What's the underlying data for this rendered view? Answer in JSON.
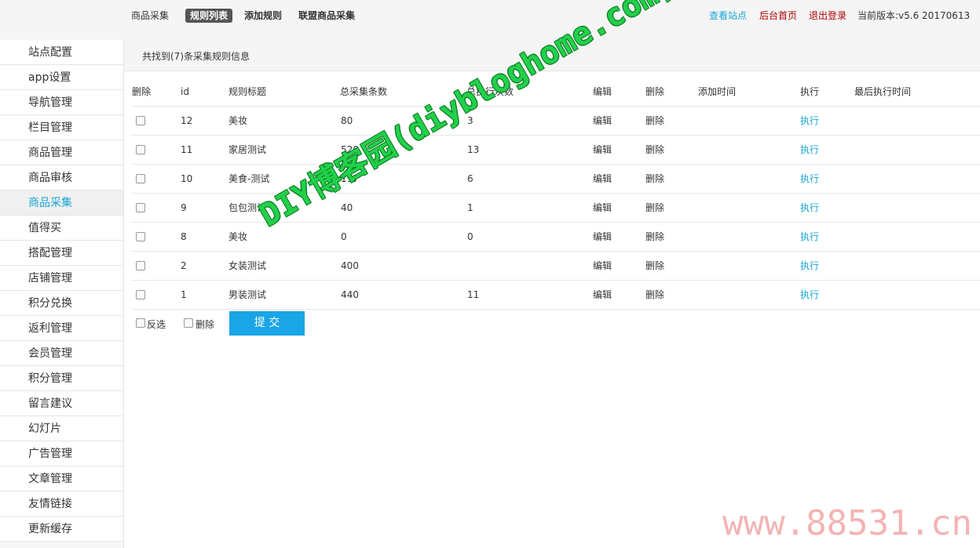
{
  "header": {
    "tabs": [
      "商品采集",
      "规则列表",
      "添加规则",
      "联盟商品采集"
    ],
    "active_tab": "规则列表",
    "links": {
      "view_site": "查看站点",
      "admin_home": "后台首页",
      "logout": "退出登录"
    },
    "version": "当前版本:v5.6 20170613"
  },
  "sidebar": {
    "items": [
      {
        "label": "站点配置"
      },
      {
        "label": "app设置"
      },
      {
        "label": "导航管理"
      },
      {
        "label": "栏目管理"
      },
      {
        "label": "商品管理"
      },
      {
        "label": "商品审核"
      },
      {
        "label": "商品采集",
        "active": true
      },
      {
        "label": "值得买"
      },
      {
        "label": "搭配管理"
      },
      {
        "label": "店铺管理"
      },
      {
        "label": "积分兑换"
      },
      {
        "label": "返利管理"
      },
      {
        "label": "会员管理"
      },
      {
        "label": "积分管理"
      },
      {
        "label": "留言建议"
      },
      {
        "label": "幻灯片"
      },
      {
        "label": "广告管理"
      },
      {
        "label": "文章管理"
      },
      {
        "label": "友情链接"
      },
      {
        "label": "更新缓存"
      }
    ]
  },
  "main": {
    "info": "共找到(7)条采集规则信息",
    "columns": [
      "删除",
      "id",
      "规则标题",
      "总采集条数",
      "总执行次数",
      "编辑",
      "删除",
      "添加时间",
      "执行",
      "最后执行时间"
    ],
    "rows": [
      {
        "id": "12",
        "title": "美妆",
        "total": "80",
        "runs": "3",
        "edit": "编辑",
        "delete": "删除",
        "added": "",
        "exec": "执行",
        "last": ""
      },
      {
        "id": "11",
        "title": "家居测试",
        "total": "520",
        "runs": "13",
        "edit": "编辑",
        "delete": "删除",
        "added": "",
        "exec": "执行",
        "last": ""
      },
      {
        "id": "10",
        "title": "美食-测试",
        "total": "197",
        "runs": "6",
        "edit": "编辑",
        "delete": "删除",
        "added": "",
        "exec": "执行",
        "last": ""
      },
      {
        "id": "9",
        "title": "包包测试",
        "total": "40",
        "runs": "1",
        "edit": "编辑",
        "delete": "删除",
        "added": "",
        "exec": "执行",
        "last": ""
      },
      {
        "id": "8",
        "title": "美妆",
        "total": "0",
        "runs": "0",
        "edit": "编辑",
        "delete": "删除",
        "added": "",
        "exec": "执行",
        "last": ""
      },
      {
        "id": "2",
        "title": "女装测试",
        "total": "400",
        "runs": "",
        "edit": "编辑",
        "delete": "删除",
        "added": "",
        "exec": "执行",
        "last": ""
      },
      {
        "id": "1",
        "title": "男装测试",
        "total": "440",
        "runs": "11",
        "edit": "编辑",
        "delete": "删除",
        "added": "",
        "exec": "执行",
        "last": ""
      }
    ],
    "footer": {
      "invert_label": "反选",
      "delete_label": "删除",
      "submit_label": "提 交"
    }
  },
  "watermarks": {
    "diagonal": "DIY博客园(diybloghome.com)",
    "corner": "www.88531.cn"
  },
  "colors": {
    "accent": "#1aa5d6",
    "submit": "#1aa5e6",
    "active_tab_bg": "#555555"
  }
}
